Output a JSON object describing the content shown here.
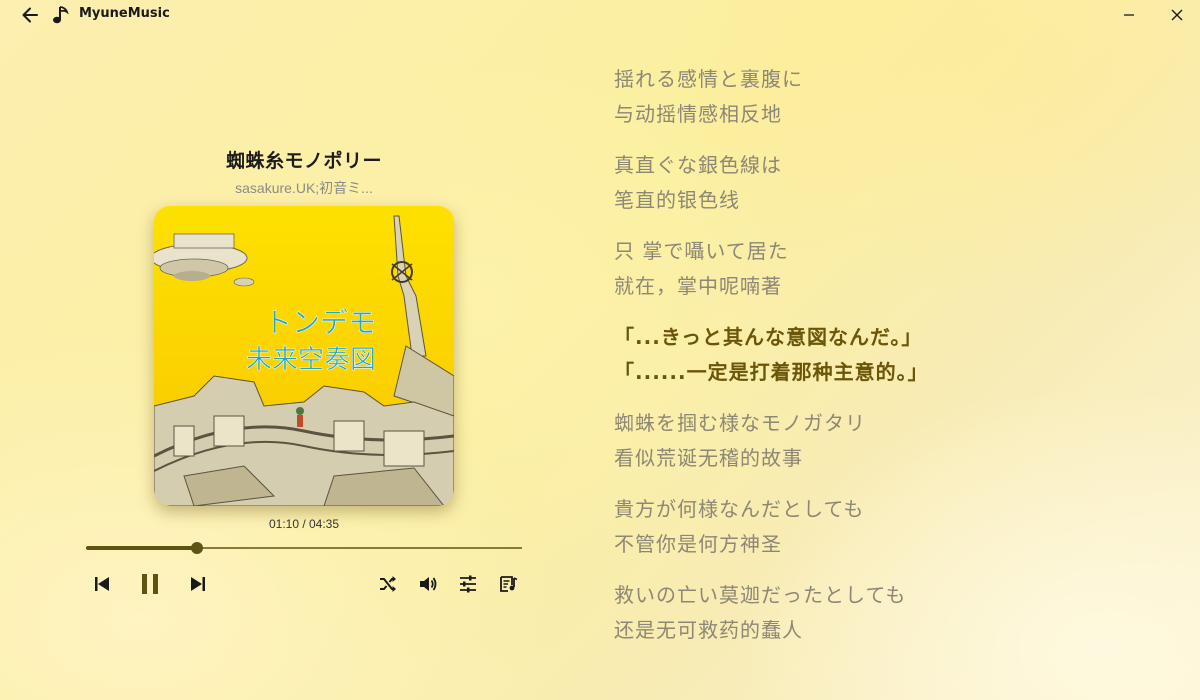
{
  "app": {
    "title": "MyuneMusic"
  },
  "player": {
    "title": "蜘蛛糸モノポリー",
    "artist": "sasakure.UK;初音ミ...",
    "cover_text_line1": "トンデモ",
    "cover_text_line2": "未来空奏図",
    "time_display": "01:10 / 04:35",
    "progress_fraction": 0.255
  },
  "lyrics": [
    {
      "original": "揺れる感情と裏腹に",
      "translation": "与动摇情感相反地",
      "current": false
    },
    {
      "original": "真直ぐな銀色線は",
      "translation": "笔直的银色线",
      "current": false
    },
    {
      "original": "只 掌で囁いて居た",
      "translation": "就在，掌中呢喃著",
      "current": false
    },
    {
      "original": "「...きっと其んな意図なんだ。」",
      "translation": "「......一定是打着那种主意的。」",
      "current": true
    },
    {
      "original": "蜘蛛を掴む様なモノガタリ",
      "translation": "看似荒诞无稽的故事",
      "current": false
    },
    {
      "original": "貴方が何様なんだとしても",
      "translation": "不管你是何方神圣",
      "current": false
    },
    {
      "original": "救いの亡い莫迦だったとしても",
      "translation": "还是无可救药的蠢人",
      "current": false
    }
  ],
  "colors": {
    "accent": "#5f5312",
    "current_lyric": "#6a5508",
    "lyric": "#8d8775"
  },
  "icons": {
    "back": "arrow-left-icon",
    "app": "music-note-icon",
    "minimize": "minimize-icon",
    "close": "close-icon",
    "previous": "skip-previous-icon",
    "pause": "pause-icon",
    "next": "skip-next-icon",
    "shuffle": "shuffle-icon",
    "volume": "volume-icon",
    "equalizer": "equalizer-icon",
    "playlist": "playlist-icon"
  }
}
